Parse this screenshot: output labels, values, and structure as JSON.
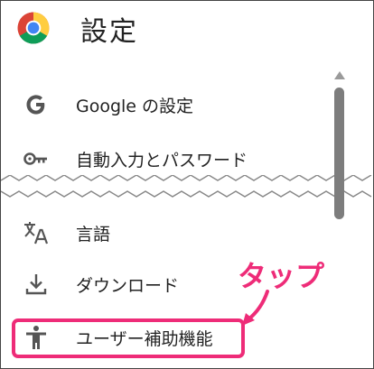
{
  "header": {
    "title": "設定",
    "logo_icon": "chrome-logo-icon"
  },
  "menu": [
    {
      "label": "Google の設定",
      "icon": "google-g-icon"
    },
    {
      "label": "自動入力とパスワード",
      "icon": "key-icon"
    },
    {
      "label": "言語",
      "icon": "translate-icon"
    },
    {
      "label": "ダウンロード",
      "icon": "download-icon"
    },
    {
      "label": "ユーザー補助機能",
      "icon": "accessibility-icon"
    }
  ],
  "annotation": {
    "text": "タップ",
    "color": "#ee2c78"
  },
  "colors": {
    "accent": "#ee2c78",
    "text": "#222222",
    "icon": "#555555",
    "scrollbar": "#7d7d7d"
  }
}
